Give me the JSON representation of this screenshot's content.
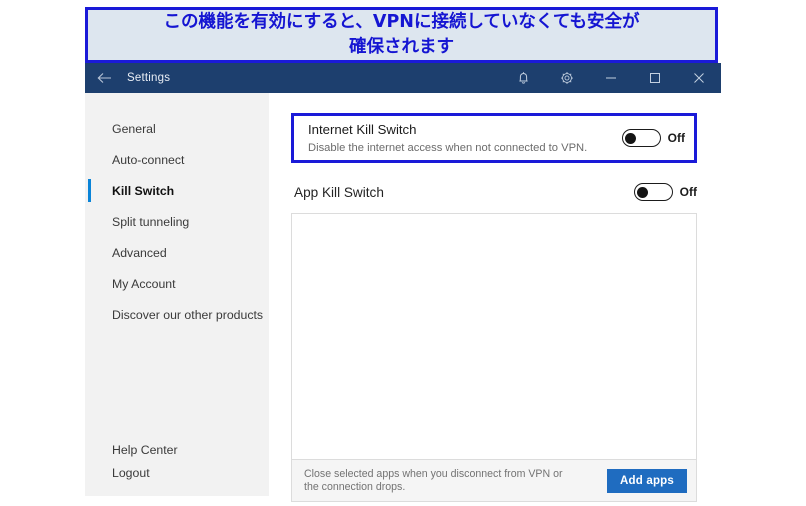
{
  "annotation": {
    "text": "この機能を有効にすると、VPNに接続していなくても安全が\n確保されます",
    "border_color": "#1a1ad8",
    "background_color": "#dde6ef",
    "text_color": "#1515d2"
  },
  "titlebar": {
    "back_label": "←",
    "title": "Settings",
    "background_color": "#1d3f6e",
    "icons": [
      "bell-icon",
      "gear-icon",
      "minimize-icon",
      "maximize-icon",
      "close-icon"
    ]
  },
  "sidebar": {
    "background_color": "#f2f2f2",
    "accent_color": "#0a84d8",
    "items": [
      {
        "label": "General",
        "active": false
      },
      {
        "label": "Auto-connect",
        "active": false
      },
      {
        "label": "Kill Switch",
        "active": true
      },
      {
        "label": "Split tunneling",
        "active": false
      },
      {
        "label": "Advanced",
        "active": false
      },
      {
        "label": "My Account",
        "active": false
      },
      {
        "label": "Discover our other products",
        "active": false
      }
    ],
    "bottom_items": [
      {
        "label": "Help Center"
      },
      {
        "label": "Logout"
      }
    ]
  },
  "main": {
    "internet_kill_switch": {
      "title": "Internet Kill Switch",
      "description": "Disable the internet access when not connected to VPN.",
      "toggle_state": "Off",
      "highlighted": true
    },
    "app_kill_switch": {
      "title": "App Kill Switch",
      "toggle_state": "Off"
    },
    "app_list": {
      "items": []
    },
    "footer": {
      "text": "Close selected apps when you disconnect from VPN or\nthe connection drops.",
      "button_label": "Add apps",
      "button_color": "#1f6cc0"
    }
  }
}
